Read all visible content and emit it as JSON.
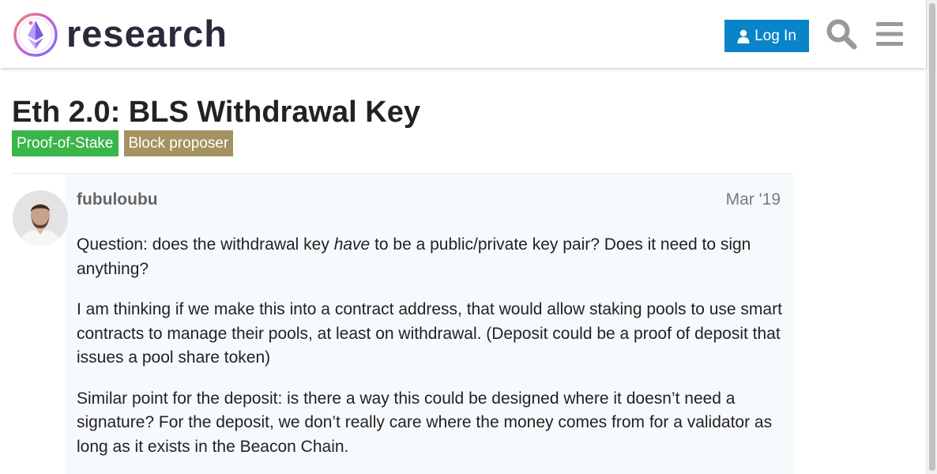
{
  "header": {
    "brand": "research",
    "login_label": "Log In"
  },
  "topic": {
    "title": "Eth 2.0: BLS Withdrawal Key",
    "tags": [
      "Proof-of-Stake",
      "Block proposer"
    ]
  },
  "post": {
    "username": "fubuloubu",
    "date": "Mar '19",
    "p1_before": "Question: does the withdrawal key ",
    "p1_em": "have",
    "p1_after": " to be a public/private key pair? Does it need to sign anything?",
    "p2": "I am thinking if we make this into a contract address, that would allow staking pools to use smart contracts to manage their pools, at least on withdrawal. (Deposit could be a proof of deposit that issues a pool share token)",
    "p3": "Similar point for the deposit: is there a way this could be designed where it doesn’t need a signature? For the deposit, we don’t really care where the money comes from for a validator as long as it exists in the Beacon Chain."
  },
  "colors": {
    "login_button": "#0a84c8",
    "tag_proof_of_stake": "#3ab54a",
    "tag_block_proposer": "#a49360",
    "post_background": "#f7fafd"
  },
  "icons": {
    "logo": "ethereum-research-logo",
    "login": "user-icon",
    "search": "search-icon",
    "menu": "hamburger-menu-icon"
  }
}
